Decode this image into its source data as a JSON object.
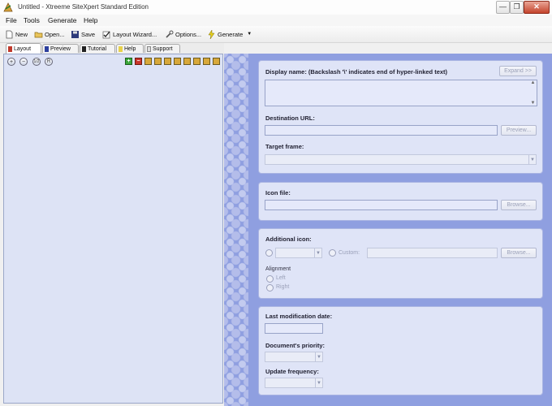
{
  "window": {
    "title": "Untitled - Xtreeme SiteXpert Standard Edition",
    "controls": {
      "minimize": "—",
      "maximize": "❐",
      "close": "✕"
    }
  },
  "menu": [
    "File",
    "Tools",
    "Generate",
    "Help"
  ],
  "toolbar": {
    "new": "New",
    "open": "Open...",
    "save": "Save",
    "layout_wizard": "Layout Wizard...",
    "options": "Options...",
    "generate": "Generate"
  },
  "tabs": [
    "Layout",
    "Preview",
    "Tutorial",
    "Help",
    "Support"
  ],
  "tree_buttons": [
    "+",
    "−",
    "1/2",
    "R"
  ],
  "form": {
    "display_name_label": "Display name: (Backslash '\\' indicates end of hyper-linked text)",
    "expand_button": "Expand >>",
    "destination_url_label": "Destination URL:",
    "preview_button": "Preview...",
    "target_frame_label": "Target frame:",
    "icon_file_label": "Icon file:",
    "browse_button": "Browse...",
    "additional_icon_label": "Additional icon:",
    "custom_label": "Custom:",
    "alignment_label": "Alignment",
    "align_left": "Left",
    "align_right": "Right",
    "last_mod_label": "Last modification date:",
    "priority_label": "Document's priority:",
    "update_freq_label": "Update frequency:"
  },
  "colors": {
    "panel_bg": "#dde3f5",
    "right_bg": "#8f9fe0",
    "card_bg": "#dfe4f7"
  }
}
